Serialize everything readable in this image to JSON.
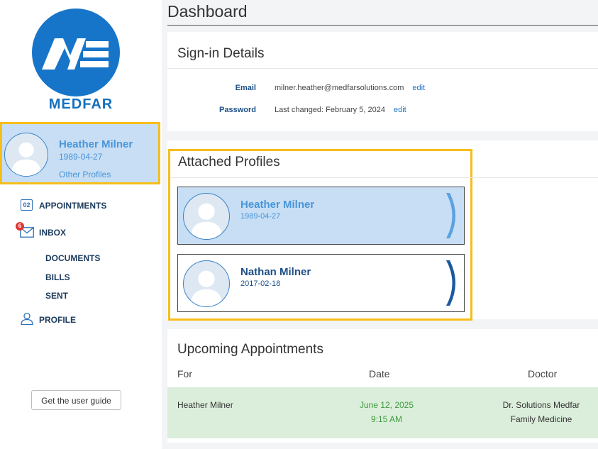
{
  "brand": {
    "logo_initials": "ME",
    "name": "MEDFAR",
    "accent": "#1775c9",
    "highlight": "#f8be18"
  },
  "current_profile": {
    "name": "Heather Milner",
    "dob": "1989-04-27",
    "other_link": "Other Profiles"
  },
  "nav": {
    "appointments": {
      "label": "APPOINTMENTS",
      "icon": "calendar-icon",
      "icon_text": "02"
    },
    "inbox": {
      "label": "INBOX",
      "icon": "mail-icon",
      "badge": "6"
    },
    "documents": "DOCUMENTS",
    "bills": "BILLS",
    "sent": "SENT",
    "profile": {
      "label": "PROFILE",
      "icon": "person-icon"
    }
  },
  "guide_button": "Get the user guide",
  "dashboard": {
    "title": "Dashboard",
    "signin": {
      "title": "Sign-in Details",
      "email_label": "Email",
      "email_value": "milner.heather@medfarsolutions.com",
      "password_label": "Password",
      "password_value": "Last changed: February 5, 2024",
      "edit": "edit"
    },
    "attached": {
      "title": "Attached Profiles",
      "profiles": [
        {
          "name": "Heather Milner",
          "dob": "1989-04-27",
          "active": true
        },
        {
          "name": "Nathan Milner",
          "dob": "2017-02-18",
          "active": false
        }
      ]
    },
    "appointments": {
      "title": "Upcoming Appointments",
      "columns": [
        "For",
        "Date",
        "Doctor"
      ],
      "rows": [
        {
          "for": "Heather Milner",
          "date": "June 12, 2025",
          "time": "9:15 AM",
          "doctor": "Dr. Solutions Medfar",
          "specialty": "Family Medicine"
        }
      ]
    }
  }
}
